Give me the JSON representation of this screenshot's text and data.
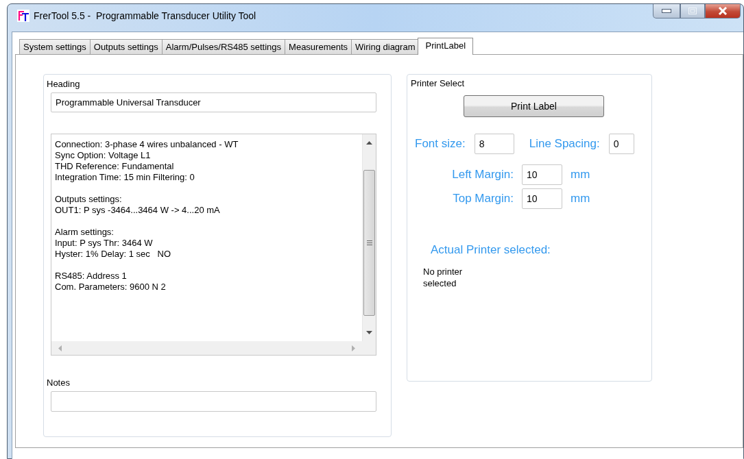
{
  "window": {
    "title": "FrerTool 5.5 -  Programmable Transducer Utility Tool"
  },
  "tabs": [
    {
      "label": "System settings",
      "selected": false
    },
    {
      "label": "Outputs settings",
      "selected": false
    },
    {
      "label": "Alarm/Pulses/RS485 settings",
      "selected": false
    },
    {
      "label": "Measurements",
      "selected": false
    },
    {
      "label": "Wiring diagram",
      "selected": false
    },
    {
      "label": "PrintLabel",
      "selected": true
    }
  ],
  "heading": {
    "label": "Heading",
    "value": "Programmable Universal Transducer"
  },
  "summary": {
    "paragraphs": [
      [
        "Connection: 3-phase 4 wires unbalanced - WT",
        "Sync Option: Voltage L1",
        "THD Reference: Fundamental",
        "Integration Time: 15 min Filtering: 0"
      ],
      [
        "Outputs settings:",
        "OUT1: P sys -3464...3464 W -> 4...20 mA"
      ],
      [
        "Alarm settings:",
        "Input: P sys Thr: 3464 W",
        "Hyster: 1% Delay: 1 sec   NO"
      ],
      [
        "RS485: Address 1",
        "Com. Parameters: 9600 N 2"
      ]
    ]
  },
  "notes": {
    "label": "Notes"
  },
  "printer_select": {
    "title": "Printer Select",
    "button": "Print Label",
    "fields": [
      {
        "label": "Font size:",
        "value": "8"
      },
      {
        "label": "Line Spacing:",
        "value": "0"
      },
      {
        "label": "Left Margin:",
        "value": "10",
        "unit": "mm"
      },
      {
        "label": "Top Margin:",
        "value": "10",
        "unit": "mm"
      }
    ],
    "actual_label": "Actual Printer selected:",
    "actual_value": "No printer selected"
  }
}
